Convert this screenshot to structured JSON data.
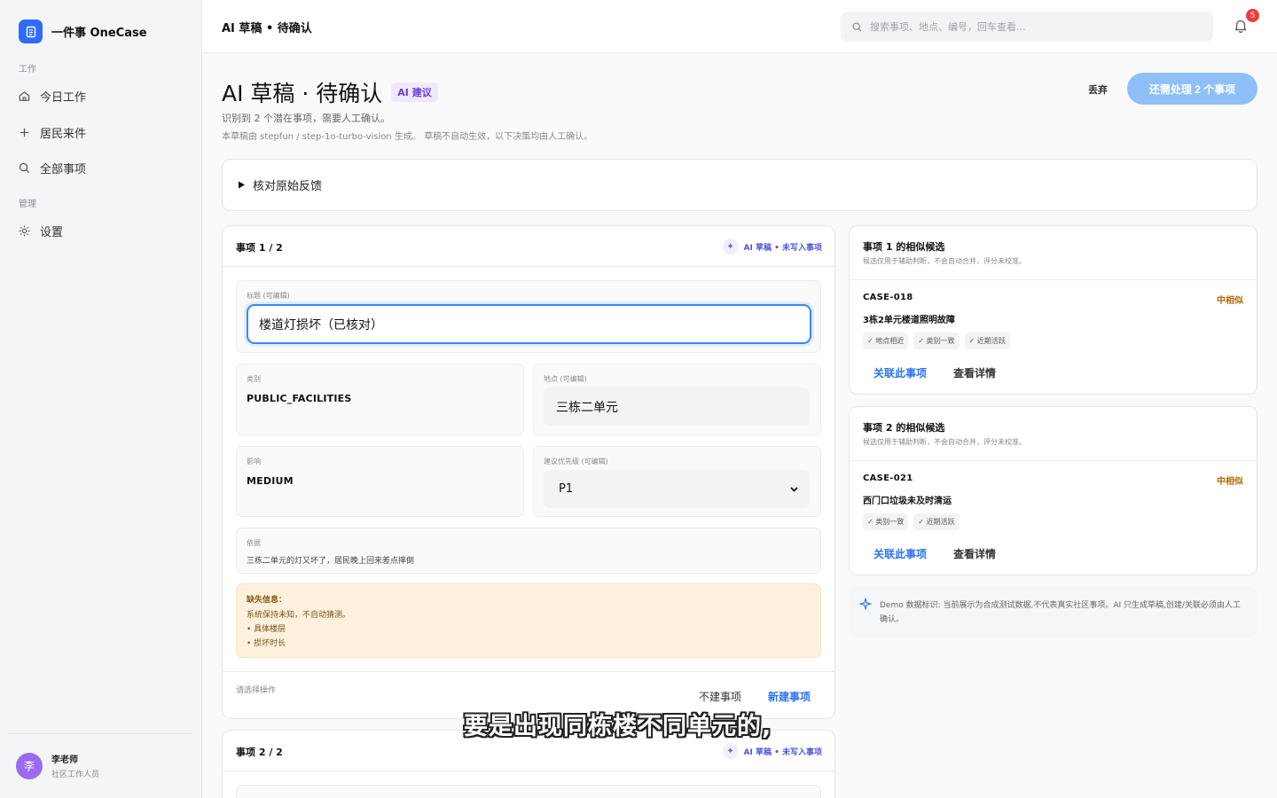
{
  "colors": {
    "accent": "#2f6bff",
    "primary_button": "#8ec0f8",
    "ai_purple": "#6b3fd6",
    "warning_bg": "#fdf1de",
    "badge_red": "#ef3b3b",
    "similarity": "#b06a00"
  },
  "sidebar": {
    "app_name": "一件事 OneCase",
    "logo_icon": "document-icon",
    "section_work": "工作",
    "items": [
      {
        "label": "今日工作",
        "icon": "home-icon"
      },
      {
        "label": "居民来件",
        "icon": "plus-icon"
      },
      {
        "label": "全部事项",
        "icon": "search-icon"
      }
    ],
    "section_manage": "管理",
    "settings": {
      "label": "设置",
      "icon": "gear-icon"
    },
    "user": {
      "avatar_text": "李",
      "name": "李老师",
      "role": "社区工作人员"
    }
  },
  "topbar": {
    "breadcrumb": "AI 草稿 • 待确认",
    "search_placeholder": "搜索事项、地点、编号，回车查看...",
    "notification_count": "5"
  },
  "header": {
    "title": "AI 草稿 · 待确认",
    "ai_tag": "AI 建议",
    "subtitle": "识别到 2 个潜在事项，需要人工确认。",
    "meta": "本草稿由 stepfun / step-1o-turbo-vision 生成。 草稿不自动生效，以下决策均由人工确认。",
    "discard_label": "丢弃",
    "primary_label": "还需处理 2 个事项"
  },
  "feedback": {
    "label": "核对原始反馈"
  },
  "items": [
    {
      "heading": "事项 1 / 2",
      "tag": "AI 草稿 • 未写入事项",
      "title_label": "标题 (可编辑)",
      "title_value": "楼道灯损坏（已核对）",
      "category_label": "类别",
      "category_value": "PUBLIC_FACILITIES",
      "location_label": "地点 (可编辑)",
      "location_value": "三栋二单元",
      "impact_label": "影响",
      "impact_value": "MEDIUM",
      "priority_label": "建议优先级 (可编辑)",
      "priority_value": "P1",
      "basis_label": "依据",
      "basis_value": "三栋二单元的灯又坏了，居民晚上回来差点摔倒",
      "missing_title": "缺失信息：",
      "missing_desc": "系统保持未知，不自动猜测。",
      "missing_items": [
        "• 具体楼层",
        "• 损坏时长"
      ],
      "action_hint": "请选择操作",
      "skip_label": "不建事项",
      "create_label": "新建事项"
    },
    {
      "heading": "事项 2 / 2",
      "tag": "AI 草稿 • 未写入事项"
    }
  ],
  "candidates": [
    {
      "heading": "事项 1 的相似候选",
      "sub": "候选仅用于辅助判断，不会自动合并，评分未校准。",
      "case_id": "CASE-018",
      "similarity": "中相似",
      "title": "3栋2单元楼道照明故障",
      "chips": [
        "✓ 地点相近",
        "✓ 类别一致",
        "✓ 近期活跃"
      ],
      "link_label": "关联此事项",
      "detail_label": "查看详情"
    },
    {
      "heading": "事项 2 的相似候选",
      "sub": "候选仅用于辅助判断，不会自动合并，评分未校准。",
      "case_id": "CASE-021",
      "similarity": "中相似",
      "title": "西门口垃圾未及时清运",
      "chips": [
        "✓ 类别一致",
        "✓ 近期活跃"
      ],
      "link_label": "关联此事项",
      "detail_label": "查看详情"
    }
  ],
  "demo_note": "Demo 数据标识: 当前展示为合成测试数据,不代表真实社区事项。AI 只生成草稿,创建/关联必须由人工确认。",
  "caption": "要是出现同栋楼不同单元的,"
}
